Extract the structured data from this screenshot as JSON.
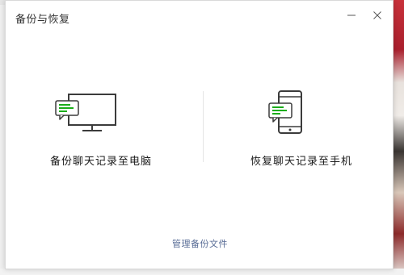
{
  "window": {
    "title": "备份与恢复",
    "minimize_icon": "minimize-icon",
    "close_icon": "close-icon"
  },
  "options": {
    "backup": {
      "label": "备份聊天记录至电脑",
      "icon": "monitor-chat-icon"
    },
    "restore": {
      "label": "恢复聊天记录至手机",
      "icon": "phone-chat-icon"
    }
  },
  "footer": {
    "manage_link": "管理备份文件"
  },
  "colors": {
    "accent_green": "#1aad19",
    "link_blue": "#576b95",
    "icon_gray": "#3b3b3b"
  }
}
